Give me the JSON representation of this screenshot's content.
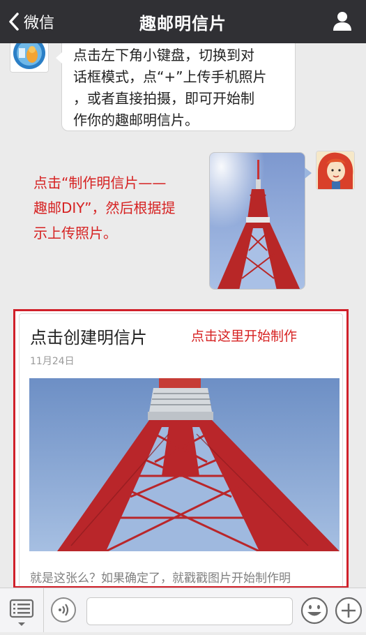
{
  "nav": {
    "back_label": "微信",
    "title": "趣邮明信片",
    "back_icon": "chevron-left-icon",
    "profile_icon": "person-icon"
  },
  "messages": {
    "incoming_text_lines": [
      "点击左下角小键盘，切换到对",
      "话框模式，点“+”上传手机照片",
      "，或者直接拍摄，即可开始制",
      "作你的趣邮明信片。"
    ],
    "annotation_lines": [
      "点击“制作明信片——",
      "趣邮DIY”，然后根据提",
      "示上传照片。"
    ]
  },
  "card": {
    "title": "点击创建明信片",
    "annotation": "点击这里开始制作",
    "date": "11月24日",
    "description": "就是这张么？如果确定了，就戳戳图片开始制作明"
  },
  "toolbar": {
    "menu_icon": "menu-list-icon",
    "voice_icon": "voice-icon",
    "input_value": "",
    "emoji_icon": "emoji-icon",
    "plus_icon": "plus-icon"
  },
  "colors": {
    "navbar": "#303034",
    "annotation_red": "#d62222",
    "highlight_border": "#d0202a",
    "background": "#ebebeb"
  }
}
